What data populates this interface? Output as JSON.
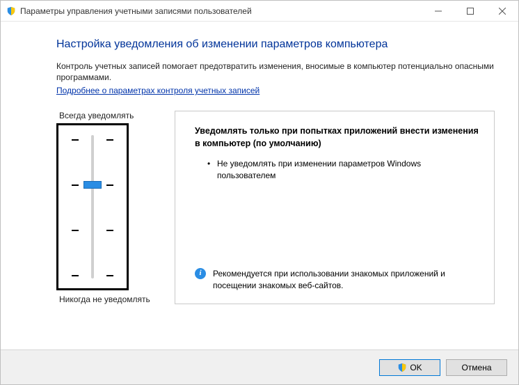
{
  "window": {
    "title": "Параметры управления учетными записями пользователей"
  },
  "content": {
    "heading": "Настройка уведомления об изменении параметров компьютера",
    "description": "Контроль учетных записей помогает предотвратить изменения, вносимые в компьютер потенциально опасными программами.",
    "link": "Подробнее о параметрах контроля учетных записей"
  },
  "slider": {
    "top_label": "Всегда уведомлять",
    "bottom_label": "Никогда не уведомлять",
    "levels": 4,
    "current_level": 2
  },
  "info": {
    "title": "Уведомлять только при попытках приложений внести изменения в компьютер (по умолчанию)",
    "bullet": "Не уведомлять при изменении параметров Windows пользователем",
    "recommendation": "Рекомендуется при использовании знакомых приложений и посещении знакомых веб-сайтов."
  },
  "buttons": {
    "ok": "OK",
    "cancel": "Отмена"
  }
}
